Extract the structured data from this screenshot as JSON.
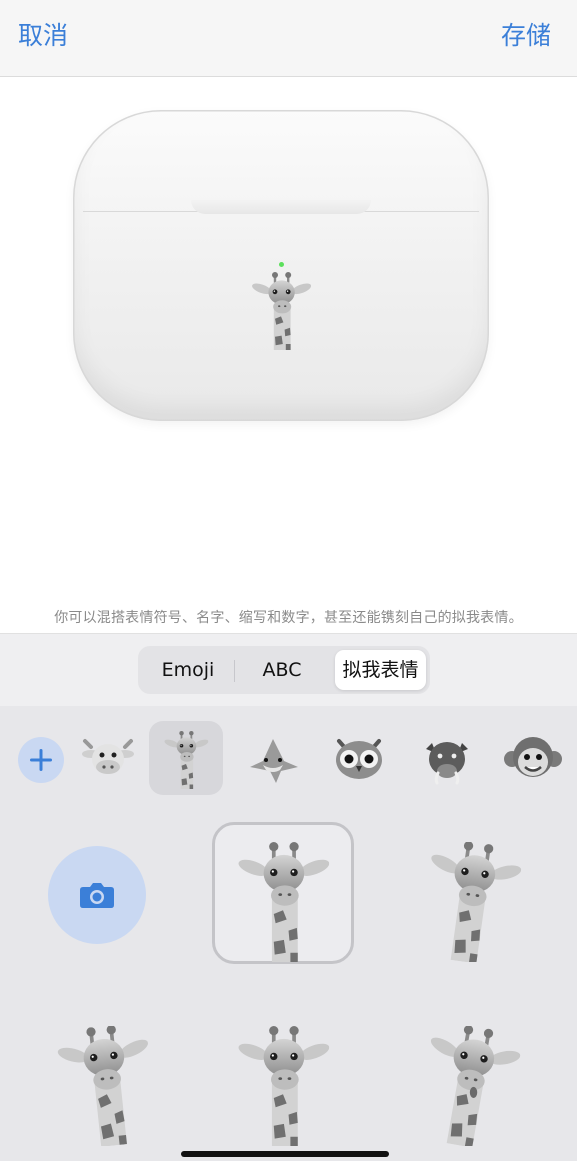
{
  "nav": {
    "cancel_label": "取消",
    "save_label": "存储"
  },
  "preview": {
    "caption": "你可以混搭表情符号、名字、缩写和数字，甚至还能镌刻自己的拟我表情。",
    "engraving_icon": "giraffe-memoji",
    "led_color": "#5ce05c"
  },
  "segments": {
    "items": [
      "Emoji",
      "ABC",
      "拟我表情"
    ],
    "selected": "拟我表情"
  },
  "memoji_strip": {
    "items": [
      "add-icon",
      "cow-memoji",
      "giraffe-memoji",
      "shark-memoji",
      "owl-memoji",
      "boar-memoji",
      "monkey-memoji"
    ],
    "selected": "giraffe-memoji"
  },
  "sticker_grid": {
    "items": [
      "camera-icon",
      "giraffe-sticker",
      "giraffe-sticker",
      "giraffe-sticker",
      "giraffe-sticker",
      "giraffe-sticker"
    ],
    "selected_index": 1
  },
  "colors": {
    "accent": "#3b7fd8",
    "accent_light": "#c9d8f2",
    "keyboard_bg": "#e7e7ea"
  }
}
